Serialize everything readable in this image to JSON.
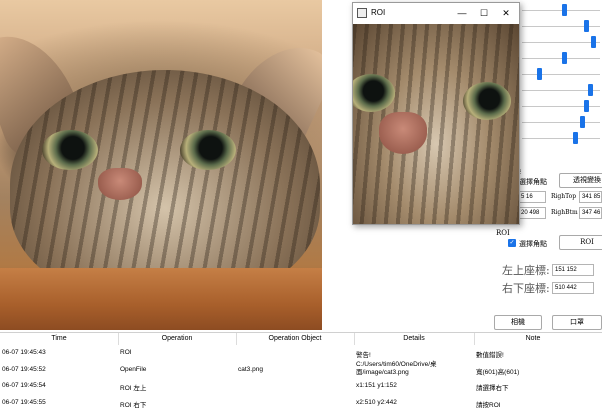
{
  "roi_window": {
    "title": "ROI",
    "minimize": "—",
    "maximize": "☐",
    "close": "✕"
  },
  "right_panel": {
    "sliders": [
      0.55,
      0.85,
      0.95,
      0.55,
      0.2,
      0.9,
      0.85,
      0.8,
      0.7
    ],
    "perspective": {
      "section_char": "換",
      "select_corner_label": "選擇角點",
      "perspective_button": "透視變換",
      "point1": "5 16",
      "righttop_label": "RighTop",
      "righttop_value": "341 85",
      "point3": "20 498",
      "rightbtm_label": "RighBtm",
      "rightbtm_value": "347 46"
    },
    "roi": {
      "section_label": "ROI",
      "select_corner_label": "選擇角點",
      "roi_button": "ROI",
      "top_left_label": "左上座標:",
      "top_left_value": "151 152",
      "bottom_right_label": "右下座標:",
      "bottom_right_value": "510 442"
    },
    "bottom_buttons": {
      "left": "相機",
      "right": "口罩"
    }
  },
  "log_table": {
    "columns": [
      "Time",
      "Operation",
      "Operation Object",
      "Details",
      "Note"
    ],
    "rows": [
      {
        "time": "06-07 19:45:43",
        "operation": "ROI",
        "object": "",
        "details": "警告!",
        "note": "數值錯誤!"
      },
      {
        "time": "06-07 19:45:52",
        "operation": "OpenFile",
        "object": "cat3.png",
        "details": "C:/Users/tim60/OneDrive/桌面/image/cat3.png",
        "note": "寬(601)高(601)"
      },
      {
        "time": "06-07 19:45:54",
        "operation": "ROI 左上",
        "object": "",
        "details": "x1:151 y1:152",
        "note": "請選擇右下"
      },
      {
        "time": "06-07 19:45:55",
        "operation": "ROI 右下",
        "object": "",
        "details": "x2:510 y2:442",
        "note": "請按ROI"
      }
    ]
  },
  "colors": {
    "accent": "#1a73e8",
    "border": "#a9a9a9"
  }
}
